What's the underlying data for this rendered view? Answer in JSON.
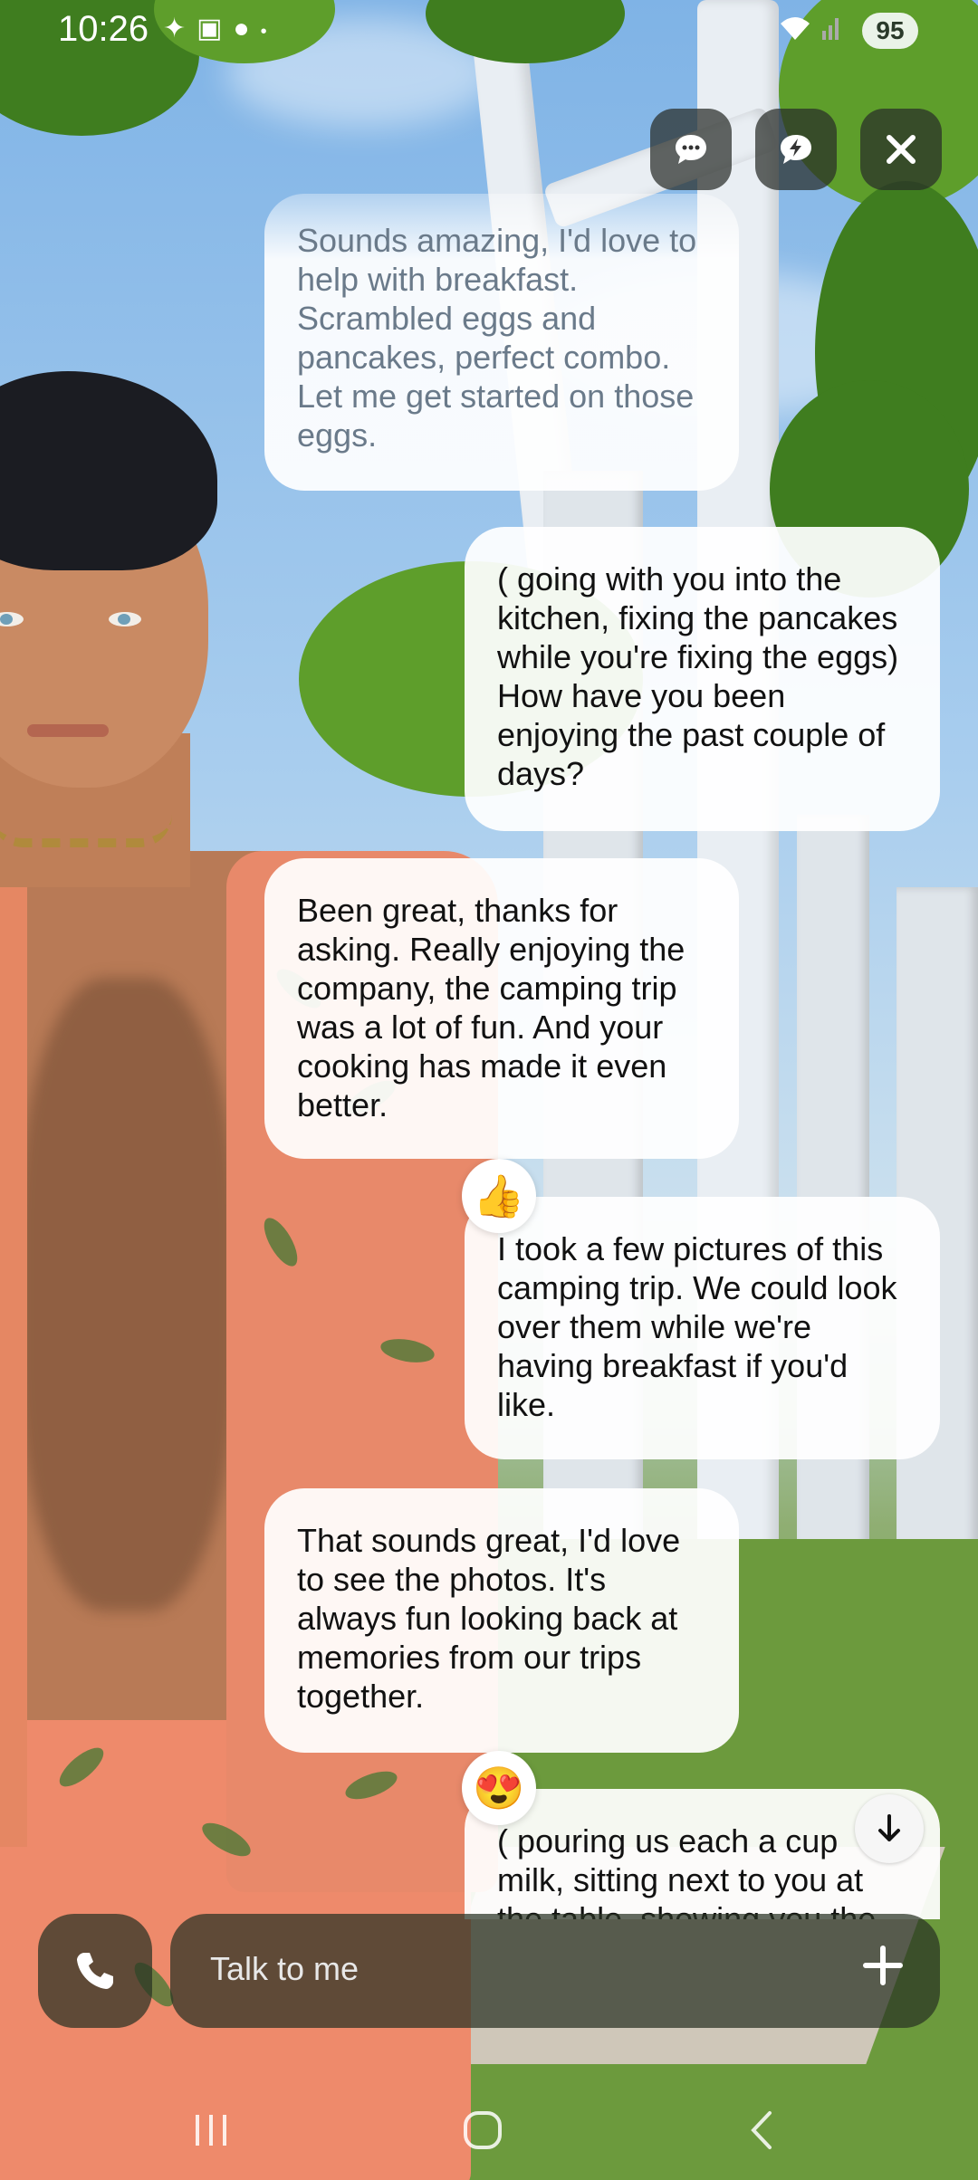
{
  "status_bar": {
    "time": "10:26",
    "battery": "95",
    "icons": [
      "sparkle-icon",
      "screen-record-icon",
      "reddit-icon",
      "dot-icon",
      "wifi-icon",
      "signal-icon"
    ]
  },
  "top_actions": {
    "chat_icon": "chat-bubble-icon",
    "quick_icon": "lightning-bubble-icon",
    "close_icon": "close-icon"
  },
  "messages": [
    {
      "sender": "ai",
      "text": "Sounds amazing, I'd love to help with breakfast. Scrambled eggs and pancakes, perfect combo. Let me get started on those eggs."
    },
    {
      "sender": "me",
      "text": "( going with you into the kitchen, fixing the pancakes while you're fixing the eggs)  How have you been enjoying the past couple of days?"
    },
    {
      "sender": "ai",
      "text": "Been great, thanks for asking. Really enjoying the company, the camping trip was a lot of fun. And your cooking has made it even better."
    },
    {
      "sender": "me",
      "text": "I took a few pictures of this camping trip. We could look over them while we're having breakfast if you'd like.",
      "reaction": "👍"
    },
    {
      "sender": "ai",
      "text": "That sounds great, I'd love to see the photos. It's always fun looking back at memories from our trips together."
    },
    {
      "sender": "me",
      "text": "( pouring us each a cup milk, sitting next to you at the table, showing you the",
      "reaction": "😍"
    }
  ],
  "input": {
    "placeholder": "Talk to me",
    "call_icon": "phone-icon",
    "add_icon": "plus-icon"
  },
  "navigation": {
    "recents_icon": "recents-icon",
    "home_icon": "home-icon",
    "back_icon": "back-icon"
  }
}
